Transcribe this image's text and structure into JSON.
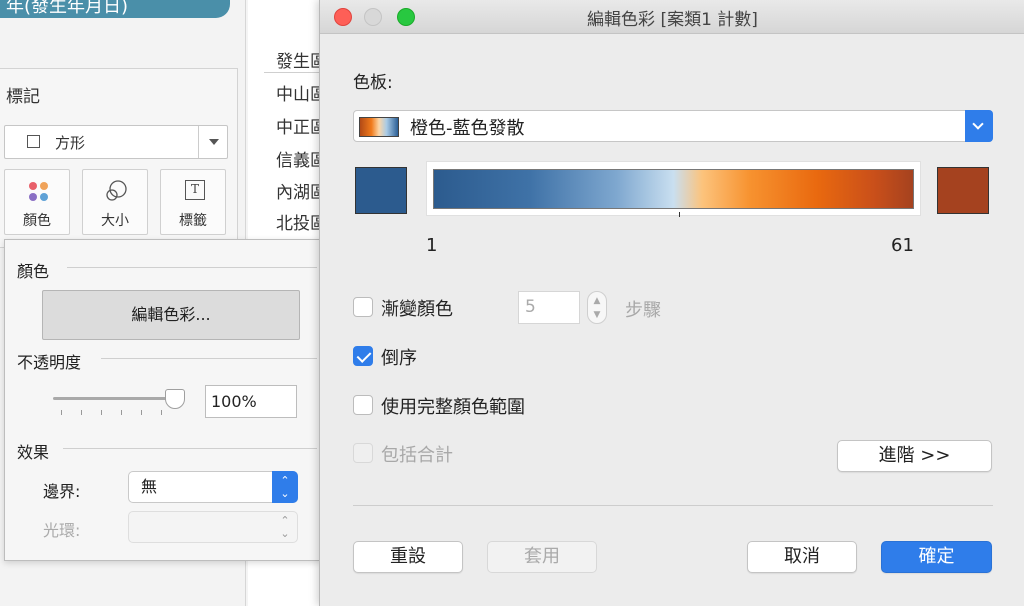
{
  "background": {
    "date_pill": "年(發生年月日)",
    "marks": {
      "title": "標記",
      "mark_type": "方形",
      "buttons": [
        {
          "label": "顏色",
          "icon": "color-dots-icon"
        },
        {
          "label": "大小",
          "icon": "size-circles-icon"
        },
        {
          "label": "標籤",
          "icon": "label-t-icon"
        }
      ]
    },
    "sheet": {
      "column_header": "發生區",
      "rows": [
        "中山區",
        "中正區",
        "信義區",
        "內湖區",
        "北投區"
      ]
    }
  },
  "color_popover": {
    "color_heading": "顏色",
    "edit_colors_button": "編輯色彩...",
    "opacity_heading": "不透明度",
    "opacity_value": "100%",
    "opacity_fraction": 1.0,
    "effects_heading": "效果",
    "border_label": "邊界:",
    "border_value": "無",
    "halo_label": "光環:",
    "halo_value": ""
  },
  "dialog": {
    "title": "編輯色彩 [案類1 計數]",
    "palette_label": "色板:",
    "palette_name": "橙色-藍色發散",
    "start_color": "#2c5b8e",
    "end_color": "#a5421f",
    "range_min": "1",
    "range_max": "61",
    "stepped_label": "漸變顏色",
    "stepped_checked": false,
    "steps_value": "5",
    "steps_unit": "步驟",
    "reversed_label": "倒序",
    "reversed_checked": true,
    "full_range_label": "使用完整顏色範圍",
    "full_range_checked": false,
    "include_totals_label": "包括合計",
    "include_totals_checked": false,
    "advanced_button": "進階 >>",
    "reset_button": "重設",
    "apply_button": "套用",
    "cancel_button": "取消",
    "ok_button": "確定"
  }
}
